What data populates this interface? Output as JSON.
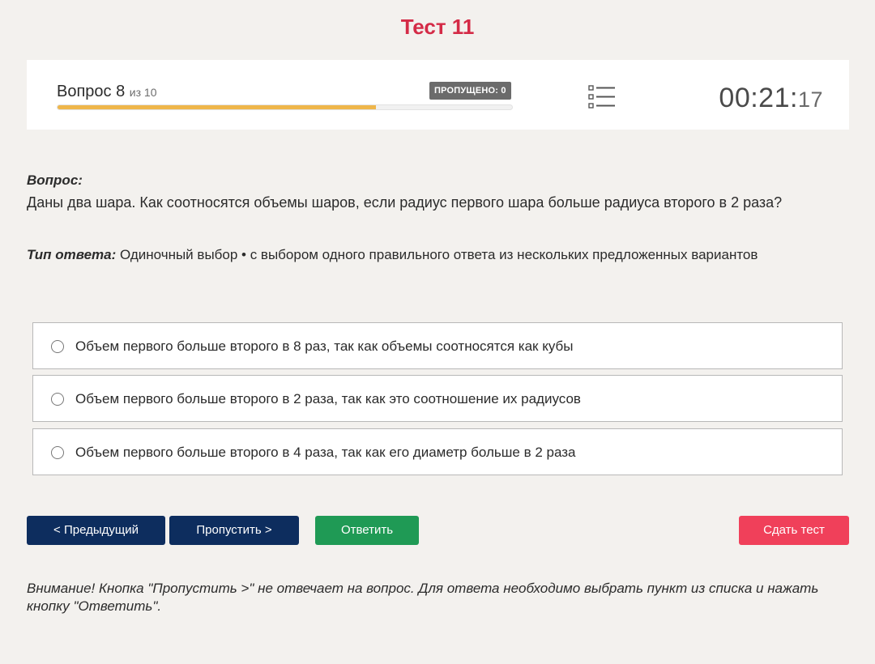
{
  "header": {
    "title": "Тест 11"
  },
  "status": {
    "question_label": "Вопрос 8",
    "question_of": "из 10",
    "skipped_badge": "ПРОПУЩЕНО: 0",
    "progress": 0.7,
    "progress_color": "#efb64a",
    "timer_main": "00:21:",
    "timer_seconds": "17",
    "list_icon": "question-list-icon"
  },
  "question": {
    "label": "Вопрос:",
    "text": "Даны два шара. Как соотносятся объемы шаров, если радиус первого шара больше радиуса второго в 2 раза?",
    "answer_type_label": "Тип ответа:",
    "answer_type_text": " Одиночный выбор • с выбором одного правильного ответа из нескольких предложенных вариантов"
  },
  "options": [
    {
      "text": "Объем первого больше второго в 8 раз, так как объемы соотносятся как кубы",
      "selected": false
    },
    {
      "text": "Объем первого больше второго в 2 раза, так как это соотношение их радиусов",
      "selected": false
    },
    {
      "text": "Объем первого больше второго в 4 раза, так как его диаметр больше в 2 раза",
      "selected": false
    }
  ],
  "buttons": {
    "prev": "< Предыдущий",
    "skip": "Пропустить >",
    "answer": "Ответить",
    "submit": "Сдать тест"
  },
  "colors": {
    "title": "#d42b47",
    "nav_button": "#0d2d5e",
    "answer_button": "#1f9a55",
    "submit_button": "#f0405a"
  },
  "notice": "Внимание! Кнопка \"Пропустить >\" не отвечает на вопрос. Для ответа необходимо выбрать пункт из списка и нажать кнопку \"Ответить\"."
}
